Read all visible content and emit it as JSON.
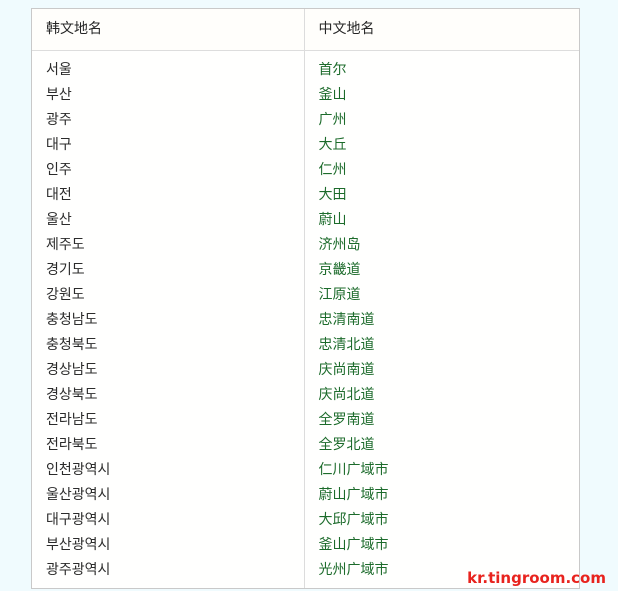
{
  "page": {
    "background_color": "#f0fbfe",
    "watermark": "kr.tingroom.com",
    "watermark_color": "#e8231e"
  },
  "table": {
    "border_color": "#c9c9c9",
    "korean_text_color": "#2b2b2b",
    "chinese_text_color": "#1c6b2b",
    "columns": [
      {
        "key": "korean",
        "header": "韩文地名"
      },
      {
        "key": "chinese",
        "header": "中文地名"
      }
    ],
    "rows": [
      {
        "korean": "서울",
        "chinese": "首尔"
      },
      {
        "korean": "부산",
        "chinese": "釜山"
      },
      {
        "korean": "광주",
        "chinese": "广州"
      },
      {
        "korean": "대구",
        "chinese": "大丘"
      },
      {
        "korean": "인주",
        "chinese": "仁州"
      },
      {
        "korean": "대전",
        "chinese": "大田"
      },
      {
        "korean": "울산",
        "chinese": "蔚山"
      },
      {
        "korean": "제주도",
        "chinese": "济州岛"
      },
      {
        "korean": "경기도",
        "chinese": "京畿道"
      },
      {
        "korean": "강원도",
        "chinese": "江原道"
      },
      {
        "korean": "충청남도",
        "chinese": "忠清南道"
      },
      {
        "korean": "충청북도",
        "chinese": "忠清北道"
      },
      {
        "korean": "경상남도",
        "chinese": "庆尚南道"
      },
      {
        "korean": "경상북도",
        "chinese": "庆尚北道"
      },
      {
        "korean": "전라남도",
        "chinese": "全罗南道"
      },
      {
        "korean": "전라북도",
        "chinese": "全罗北道"
      },
      {
        "korean": "인천광역시",
        "chinese": "仁川广域市"
      },
      {
        "korean": "울산광역시",
        "chinese": "蔚山广域市"
      },
      {
        "korean": "대구광역시",
        "chinese": "大邱广域市"
      },
      {
        "korean": "부산광역시",
        "chinese": "釜山广域市"
      },
      {
        "korean": "광주광역시",
        "chinese": "光州广域市"
      }
    ]
  }
}
